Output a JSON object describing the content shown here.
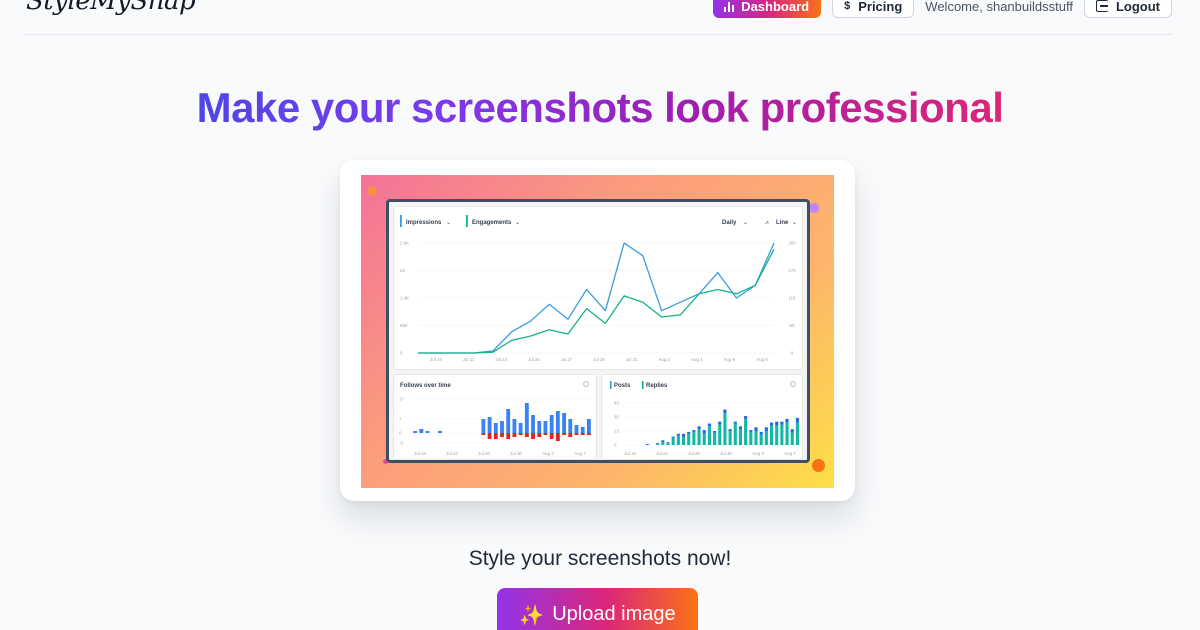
{
  "header": {
    "logo_text": "StyleMySnap",
    "dashboard_label": "Dashboard",
    "pricing_label": "Pricing",
    "pricing_icon": "dollar-icon",
    "welcome_text": "Welcome, shanbuildsstuff",
    "logout_label": "Logout",
    "logout_icon": "logout-icon"
  },
  "hero": {
    "title": "Make your screenshots look professional"
  },
  "preview": {
    "main_chart": {
      "series_labels": [
        "Impressions",
        "Engagements"
      ],
      "period_select": "Daily",
      "type_select": "Line",
      "y_left_ticks": [
        "2.6K",
        "2K",
        "1.3K",
        "650",
        "0"
      ],
      "y_right_ticks": [
        "260",
        "170",
        "110",
        "60",
        "0"
      ],
      "x_ticks": [
        "Jul 19",
        "Jul 21",
        "Jul 23",
        "Jul 25",
        "Jul 27",
        "Jul 29",
        "Jul 31",
        "Aug 2",
        "Aug 4",
        "Aug 6",
        "Aug 8"
      ],
      "series": [
        {
          "name": "Impressions",
          "color": "#3b9be0",
          "values": [
            0,
            0,
            0,
            0,
            50,
            500,
            750,
            1150,
            800,
            1500,
            1000,
            2600,
            2300,
            1000,
            1200,
            1400,
            1900,
            1300,
            1600,
            2600
          ]
        },
        {
          "name": "Engagements",
          "color": "#15b388",
          "values": [
            0,
            0,
            0,
            0,
            20,
            300,
            400,
            550,
            450,
            1050,
            700,
            1350,
            1200,
            850,
            900,
            1400,
            1500,
            1400,
            1600,
            2450
          ]
        }
      ]
    },
    "follows_chart": {
      "title": "Follows over time",
      "y_ticks": [
        "17",
        "7",
        "0",
        "-5"
      ],
      "x_ticks": [
        "Jul 19",
        "Jul 22",
        "Jul 26",
        "Jul 30",
        "Aug 3",
        "Aug 7"
      ],
      "gains": [
        1,
        2,
        1,
        0,
        1,
        0,
        0,
        0,
        0,
        0,
        0,
        7,
        8,
        5,
        6,
        12,
        7,
        5,
        15,
        9,
        6,
        6,
        9,
        11,
        10,
        7,
        4,
        3,
        7
      ],
      "losses": [
        0,
        0,
        0,
        0,
        0,
        0,
        0,
        0,
        0,
        0,
        0,
        1,
        3,
        3,
        2,
        3,
        2,
        1,
        2,
        3,
        2,
        1,
        3,
        4,
        1,
        2,
        1,
        1,
        1
      ]
    },
    "posts_chart": {
      "series_labels": [
        "Posts",
        "Replies"
      ],
      "y_ticks": [
        "45",
        "30",
        "15",
        "0"
      ],
      "x_ticks": [
        "Jul 19",
        "Jul 22",
        "Jul 26",
        "Jul 30",
        "Aug 3",
        "Aug 7"
      ],
      "posts": [
        0,
        0,
        0,
        0,
        1,
        0,
        1,
        2,
        1,
        1,
        2,
        3,
        2,
        2,
        3,
        4,
        3,
        2,
        3,
        4,
        2,
        2,
        3,
        3,
        2,
        4,
        3,
        4,
        3,
        4,
        3,
        4,
        4,
        5
      ],
      "replies": [
        0,
        0,
        0,
        0,
        0,
        0,
        1,
        3,
        2,
        8,
        10,
        9,
        12,
        14,
        17,
        12,
        20,
        13,
        22,
        34,
        15,
        23,
        17,
        28,
        14,
        15,
        11,
        15,
        21,
        21,
        22,
        24,
        13,
        24
      ]
    }
  },
  "cta": {
    "text": "Style your screenshots now!",
    "upload_icon": "✨",
    "upload_label": "Upload image"
  }
}
